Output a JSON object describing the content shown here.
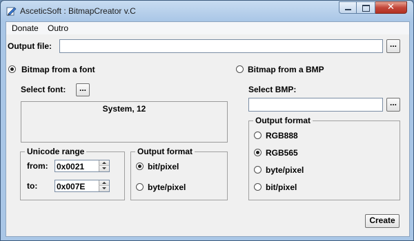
{
  "window": {
    "title": "AsceticSoft : BitmapCreator v.C",
    "close_glyph": "✕"
  },
  "menu": [
    "Donate",
    "Outro"
  ],
  "output_file": {
    "label": "Output file:",
    "value": "",
    "browse": "..."
  },
  "font_mode": {
    "label": "Bitmap from a font",
    "selected": true,
    "select_font_label": "Select font:",
    "select_font_button": "...",
    "font_display": "System, 12",
    "unicode_range": {
      "title": "Unicode range",
      "from_label": "from:",
      "from_value": "0x0021",
      "to_label": "to:",
      "to_value": "0x007E"
    },
    "output_format": {
      "title": "Output format",
      "options": [
        {
          "label": "bit/pixel",
          "checked": true
        },
        {
          "label": "byte/pixel",
          "checked": false
        }
      ]
    }
  },
  "bmp_mode": {
    "label": "Bitmap from a BMP",
    "selected": false,
    "select_bmp_label": "Select BMP:",
    "bmp_value": "",
    "browse": "...",
    "output_format": {
      "title": "Output format",
      "options": [
        {
          "label": "RGB888",
          "checked": false
        },
        {
          "label": "RGB565",
          "checked": true
        },
        {
          "label": "byte/pixel",
          "checked": false
        },
        {
          "label": "bit/pixel",
          "checked": false
        }
      ]
    }
  },
  "create_button": "Create"
}
